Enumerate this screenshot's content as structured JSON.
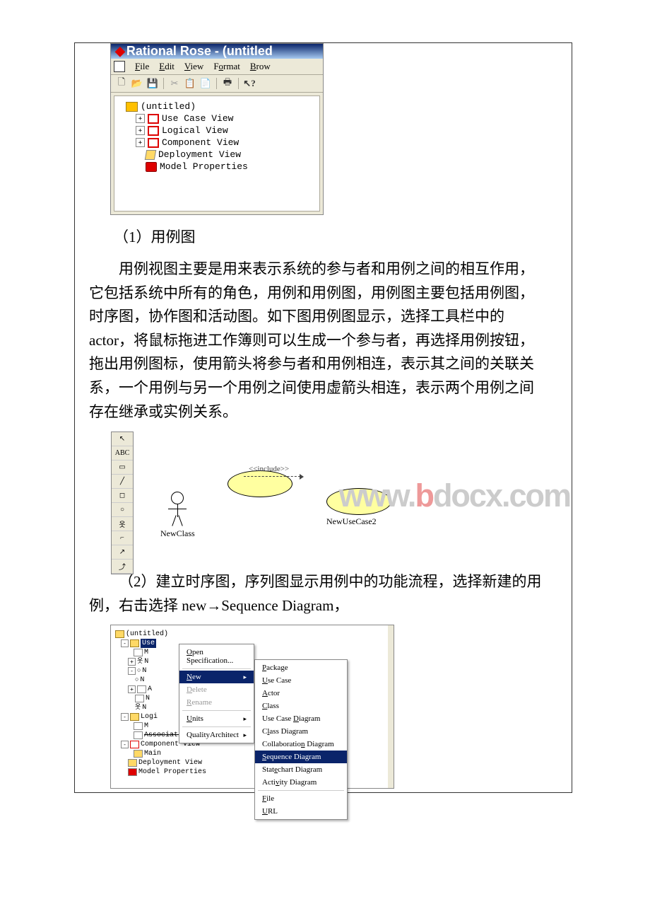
{
  "shot1": {
    "title": "Rational Rose - (untitled",
    "menu": {
      "file": "File",
      "edit": "Edit",
      "view": "View",
      "format": "Format",
      "browse": "Brow"
    },
    "tree": {
      "root": "(untitled)",
      "items": [
        {
          "label": "Use Case View",
          "expandable": true
        },
        {
          "label": "Logical View",
          "expandable": true
        },
        {
          "label": "Component View",
          "expandable": true
        },
        {
          "label": "Deployment View",
          "expandable": false
        },
        {
          "label": "Model Properties",
          "expandable": false
        }
      ]
    }
  },
  "section1_heading": "（1）用例图",
  "paragraph1": "用例视图主要是用来表示系统的参与者和用例之间的相互作用，它包括系统中所有的角色，用例和用例图，用例图主要包括用例图，时序图，协作图和活动图。如下图用例图显示，选择工具栏中的 actor，将鼠标拖进工作簿则可以生成一个参与者，再选择用例按钮，拖出用例图标，使用箭头将参与者和用例相连，表示其之间的关联关系，一个用例与另一个用例之间使用虚箭头相连，表示两个用例之间存在继承或实例关系。",
  "shot2": {
    "palette_items": [
      "↖",
      "ABC",
      "▭",
      "╱",
      "◻",
      "○",
      "옷",
      "⌐",
      "↗",
      "⤴"
    ],
    "actor_label": "NewClass",
    "usecase2_label": "NewUseCase2",
    "include_label": "<<include>>",
    "watermark": "www.bdocx.com"
  },
  "section2_text": "（2）建立时序图，序列图显示用例中的功能流程，选择新建的用例，右击选择 new→Sequence Diagram，",
  "shot3": {
    "root": "(untitled)",
    "sel_item": "Use",
    "tree_items": [
      "M",
      "N",
      "A",
      "N",
      "N",
      "Logi",
      "M",
      "Associations",
      "Component View",
      "Main",
      "Deployment View",
      "Model Properties"
    ],
    "menu1": {
      "open_spec": "Open Specification...",
      "new": "New",
      "delete": "Delete",
      "rename": "Rename",
      "units": "Units",
      "quality": "QualityArchitect"
    },
    "menu2": {
      "package": "Package",
      "use_case": "Use Case",
      "actor": "Actor",
      "class": "Class",
      "use_case_diagram": "Use Case Diagram",
      "class_diagram": "Class Diagram",
      "collab_diagram": "Collaboration Diagram",
      "sequence_diagram": "Sequence Diagram",
      "statechart_diagram": "Statechart Diagram",
      "activity_diagram": "Activity Diagram",
      "file": "File",
      "url": "URL"
    }
  }
}
